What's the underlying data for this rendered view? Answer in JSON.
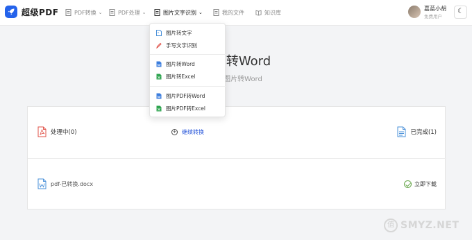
{
  "brand": {
    "name": "超级PDF"
  },
  "nav": [
    {
      "label": "PDF转换",
      "icon": "document-icon",
      "has_chevron": true,
      "active": false
    },
    {
      "label": "PDF处理",
      "icon": "document-icon",
      "has_chevron": true,
      "active": false
    },
    {
      "label": "图片文字识别",
      "icon": "document-icon",
      "has_chevron": true,
      "active": true
    },
    {
      "label": "我的文件",
      "icon": "document-icon",
      "has_chevron": false,
      "active": false
    },
    {
      "label": "知识库",
      "icon": "book-icon",
      "has_chevron": false,
      "active": false
    }
  ],
  "user": {
    "name": "嘉蓝小胡",
    "role": "免费用户"
  },
  "hero": {
    "title": "图片转Word",
    "subtitle": "免费图片转Word"
  },
  "dropdown": {
    "items": [
      {
        "label": "图片转文字",
        "icon": "image-doc-icon",
        "color": "#4a90d9"
      },
      {
        "label": "手写文字识别",
        "icon": "pen-icon",
        "color": "#e0534a"
      },
      {
        "label": "图片转Word",
        "icon": "word-icon",
        "color": "#3b7ddd"
      },
      {
        "label": "图片转Excel",
        "icon": "excel-icon",
        "color": "#2ea44f"
      },
      {
        "label": "图片PDF转Word",
        "icon": "word-icon",
        "color": "#3b7ddd"
      },
      {
        "label": "图片PDF转Excel",
        "icon": "excel-icon",
        "color": "#2ea44f"
      }
    ]
  },
  "panel": {
    "processing_label": "处理中(0)",
    "continue_label": "继续转换",
    "completed_label": "已完成(1)",
    "file_name": "pdf-已转换.docx",
    "download_label": "立即下载"
  },
  "watermark": {
    "text": "SMYZ.NET",
    "logo_char": "值"
  },
  "colors": {
    "accent": "#2563eb",
    "link": "#1d4ed8",
    "pdf_red": "#e0534a",
    "success": "#6aa84f"
  }
}
